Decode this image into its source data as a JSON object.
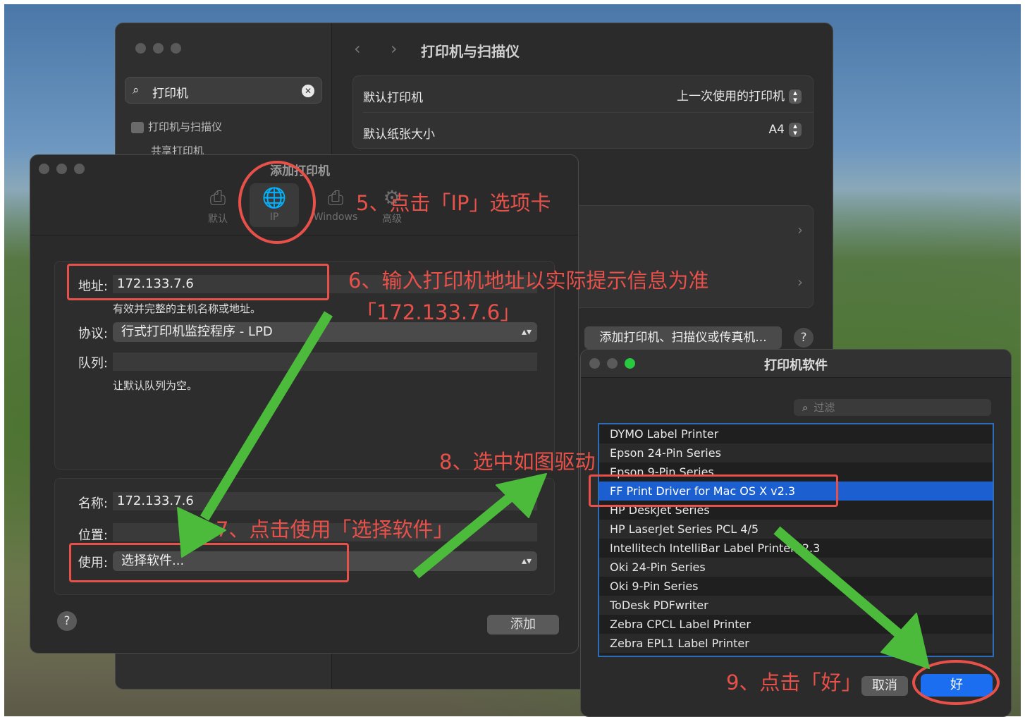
{
  "settings": {
    "search_text": "打印机",
    "sidebar_items": [
      "打印机与扫描仪",
      "共享打印机"
    ],
    "title": "打印机与扫描仪",
    "default_printer_label": "默认打印机",
    "default_printer_value": "上一次使用的打印机",
    "default_paper_label": "默认纸张大小",
    "default_paper_value": "A4",
    "add_button": "添加打印机、扫描仪或传真机...",
    "help": "?"
  },
  "add_printer": {
    "title": "添加打印机",
    "tabs": [
      "默认",
      "IP",
      "Windows",
      "高级"
    ],
    "address_label": "地址:",
    "address_value": "172.133.7.6",
    "address_hint": "有效并完整的主机名称或地址。",
    "protocol_label": "协议:",
    "protocol_value": "行式打印机监控程序 - LPD",
    "queue_label": "队列:",
    "queue_hint": "让默认队列为空。",
    "name_label": "名称:",
    "name_value": "172.133.7.6",
    "location_label": "位置:",
    "use_label": "使用:",
    "use_value": "选择软件...",
    "add_button": "添加",
    "help": "?"
  },
  "software": {
    "title": "打印机软件",
    "filter_placeholder": "过滤",
    "items": [
      "DYMO Label Printer",
      "Epson 24-Pin Series",
      "Epson 9-Pin Series",
      "FF Print Driver for Mac OS X v2.3",
      "HP DeskJet Series",
      "HP LaserJet Series PCL 4/5",
      "Intellitech IntelliBar Label Printer, 2.3",
      "Oki 24-Pin Series",
      "Oki 9-Pin Series",
      "ToDesk PDFwriter",
      "Zebra CPCL Label Printer",
      "Zebra EPL1 Label Printer"
    ],
    "selected_index": 3,
    "cancel": "取消",
    "ok": "好"
  },
  "annotations": {
    "step5": "5、点击「IP」选项卡",
    "step6_line1": "6、输入打印机地址以实际提示信息为准",
    "step6_line2": "「172.133.7.6」",
    "step7": "7、点击使用「选择软件」",
    "step8": "8、选中如图驱动",
    "step9": "9、点击「好」"
  },
  "colors": {
    "annotation": "#e8504a",
    "arrow": "#4cbb3c",
    "selection": "#1b5fd0",
    "ok_button": "#1b6ef0"
  }
}
